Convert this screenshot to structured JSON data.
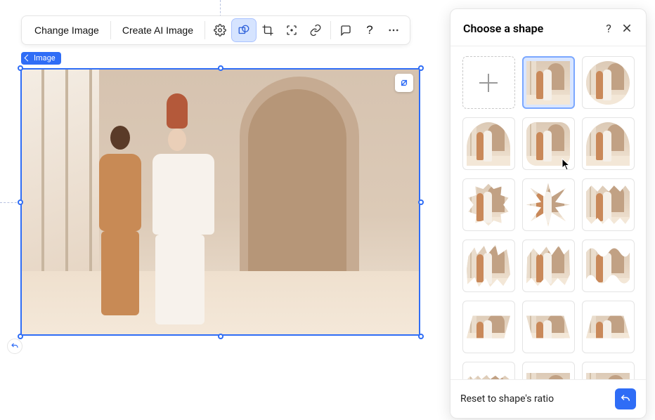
{
  "toolbar": {
    "change_image_label": "Change Image",
    "create_ai_label": "Create AI Image"
  },
  "image_tag_label": "Image",
  "panel": {
    "title": "Choose a shape",
    "reset_label": "Reset to shape's ratio"
  },
  "shapes": [
    {
      "name": "custom-shape",
      "style": "plus",
      "selected": false
    },
    {
      "name": "rectangle",
      "style": "rect",
      "selected": true
    },
    {
      "name": "circle",
      "style": "circle",
      "selected": false
    },
    {
      "name": "arch",
      "style": "arch",
      "selected": false
    },
    {
      "name": "rounded-rect",
      "style": "rounded",
      "selected": false
    },
    {
      "name": "arch-frame",
      "style": "arch",
      "selected": false
    },
    {
      "name": "flower",
      "style": "flower",
      "selected": false
    },
    {
      "name": "burst",
      "style": "burst",
      "selected": false
    },
    {
      "name": "scallop",
      "style": "scallop",
      "selected": false
    },
    {
      "name": "rough-blob-1",
      "style": "jag1",
      "selected": false
    },
    {
      "name": "rough-blob-2",
      "style": "jag2",
      "selected": false
    },
    {
      "name": "wave-rect",
      "style": "wave",
      "selected": false
    },
    {
      "name": "parallelogram-left",
      "style": "para1",
      "selected": false
    },
    {
      "name": "parallelogram-right",
      "style": "para2",
      "selected": false
    },
    {
      "name": "trapezoid",
      "style": "trap",
      "selected": false
    },
    {
      "name": "ripped-top",
      "style": "rip1",
      "selected": false
    },
    {
      "name": "rectangle-wide",
      "style": "rect",
      "selected": false
    },
    {
      "name": "ripped-bottom",
      "style": "rip2",
      "selected": false
    }
  ]
}
